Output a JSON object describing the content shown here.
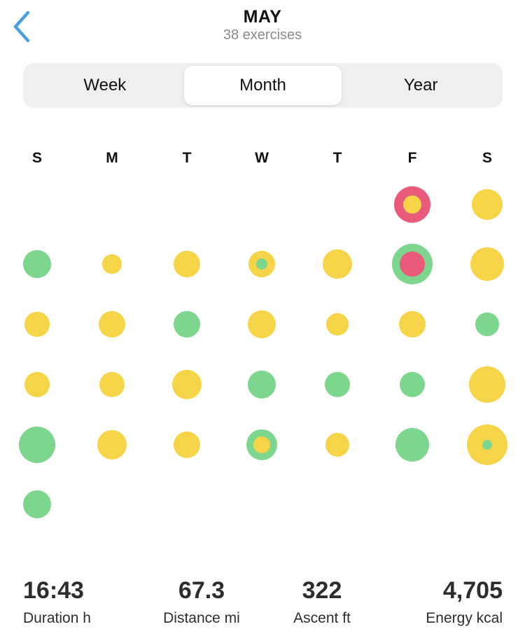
{
  "header": {
    "back_icon": "chevron-left-icon",
    "title": "MAY",
    "subtitle": "38 exercises"
  },
  "tabs": [
    {
      "label": "Week",
      "active": false
    },
    {
      "label": "Month",
      "active": true
    },
    {
      "label": "Year",
      "active": false
    }
  ],
  "colors": {
    "yellow": "#f5d547",
    "green": "#7dd68d",
    "pink": "#ea5a7b",
    "accent": "#4a9fe0"
  },
  "weekdays": [
    "S",
    "M",
    "T",
    "W",
    "T",
    "F",
    "S"
  ],
  "calendar": {
    "note": "",
    "days": [
      {
        "week": 0,
        "weekday": 5,
        "rings": [
          "pink",
          "yellow"
        ]
      },
      {
        "week": 0,
        "weekday": 6,
        "rings": [
          "yellow"
        ]
      },
      {
        "week": 1,
        "weekday": 0,
        "rings": [
          "green"
        ]
      },
      {
        "week": 1,
        "weekday": 1,
        "rings": [
          "yellow"
        ]
      },
      {
        "week": 1,
        "weekday": 2,
        "rings": [
          "yellow"
        ]
      },
      {
        "week": 1,
        "weekday": 3,
        "rings": [
          "yellow",
          "green"
        ]
      },
      {
        "week": 1,
        "weekday": 4,
        "rings": [
          "yellow"
        ]
      },
      {
        "week": 1,
        "weekday": 5,
        "rings": [
          "green",
          "pink"
        ]
      },
      {
        "week": 1,
        "weekday": 6,
        "rings": [
          "yellow"
        ]
      },
      {
        "week": 2,
        "weekday": 0,
        "rings": [
          "yellow"
        ]
      },
      {
        "week": 2,
        "weekday": 1,
        "rings": [
          "yellow"
        ]
      },
      {
        "week": 2,
        "weekday": 2,
        "rings": [
          "green"
        ]
      },
      {
        "week": 2,
        "weekday": 3,
        "rings": [
          "yellow"
        ]
      },
      {
        "week": 2,
        "weekday": 4,
        "rings": [
          "yellow"
        ]
      },
      {
        "week": 2,
        "weekday": 5,
        "rings": [
          "yellow"
        ]
      },
      {
        "week": 2,
        "weekday": 6,
        "rings": [
          "green"
        ]
      },
      {
        "week": 3,
        "weekday": 0,
        "rings": [
          "yellow"
        ]
      },
      {
        "week": 3,
        "weekday": 1,
        "rings": [
          "yellow"
        ]
      },
      {
        "week": 3,
        "weekday": 2,
        "rings": [
          "yellow"
        ]
      },
      {
        "week": 3,
        "weekday": 3,
        "rings": [
          "green"
        ]
      },
      {
        "week": 3,
        "weekday": 4,
        "rings": [
          "green"
        ]
      },
      {
        "week": 3,
        "weekday": 5,
        "rings": [
          "green"
        ]
      },
      {
        "week": 3,
        "weekday": 6,
        "rings": [
          "yellow"
        ]
      },
      {
        "week": 4,
        "weekday": 0,
        "rings": [
          "green"
        ]
      },
      {
        "week": 4,
        "weekday": 1,
        "rings": [
          "yellow"
        ]
      },
      {
        "week": 4,
        "weekday": 2,
        "rings": [
          "yellow"
        ]
      },
      {
        "week": 4,
        "weekday": 3,
        "rings": [
          "green",
          "yellow"
        ]
      },
      {
        "week": 4,
        "weekday": 4,
        "rings": [
          "yellow"
        ]
      },
      {
        "week": 4,
        "weekday": 5,
        "rings": [
          "green"
        ]
      },
      {
        "week": 4,
        "weekday": 6,
        "rings": [
          "yellow",
          "green"
        ]
      },
      {
        "week": 5,
        "weekday": 0,
        "rings": [
          "green"
        ]
      }
    ]
  },
  "stats": [
    {
      "value": "16:43",
      "label": "Duration h",
      "align": "left"
    },
    {
      "value": "67.3",
      "label": "Distance mi",
      "align": "center"
    },
    {
      "value": "322",
      "label": "Ascent ft",
      "align": "center"
    },
    {
      "value": "4,705",
      "label": "Energy kcal",
      "align": "right"
    }
  ]
}
